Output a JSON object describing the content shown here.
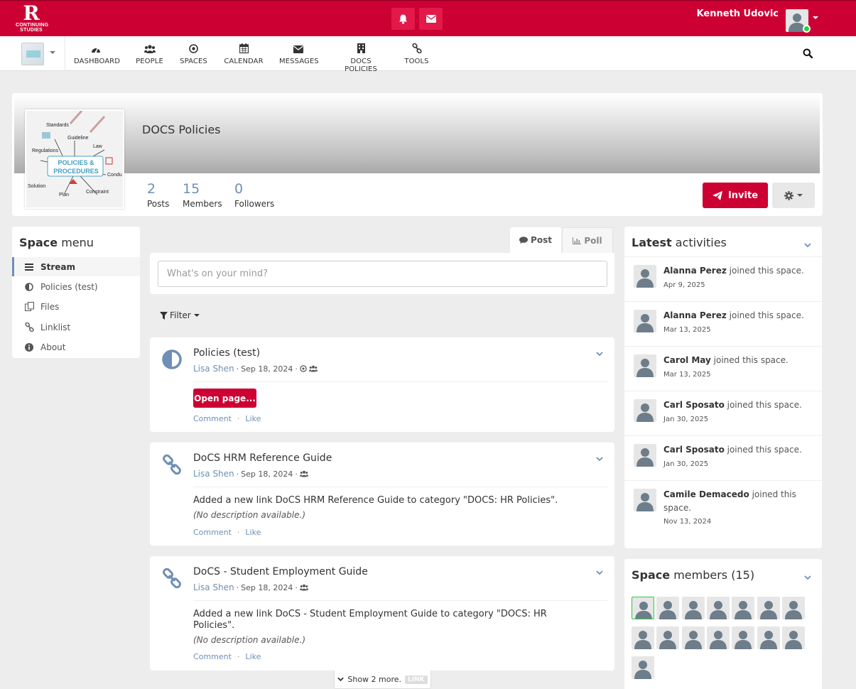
{
  "app": {
    "logo_letter": "R",
    "logo_sub": "CONTINUING STUDIES",
    "user_name": "Kenneth Udovic"
  },
  "nav": {
    "items": [
      {
        "label": "DASHBOARD",
        "icon": "dashboard-icon"
      },
      {
        "label": "PEOPLE",
        "icon": "people-icon"
      },
      {
        "label": "SPACES",
        "icon": "spaces-icon"
      },
      {
        "label": "CALENDAR",
        "icon": "calendar-icon"
      },
      {
        "label": "MESSAGES",
        "icon": "envelope-icon"
      },
      {
        "label": "DOCS POLICIES",
        "icon": "building-icon"
      },
      {
        "label": "TOOLS",
        "icon": "link-icon"
      }
    ]
  },
  "space": {
    "title": "DOCS Policies",
    "stats": [
      {
        "value": "2",
        "label": "Posts"
      },
      {
        "value": "15",
        "label": "Members"
      },
      {
        "value": "0",
        "label": "Followers"
      }
    ],
    "invite_label": "Invite",
    "image_words": [
      "Standards",
      "Guideline",
      "Regulations",
      "Law",
      "POLICIES &",
      "PROCEDURES",
      "Solution",
      "Plan",
      "Constraint",
      "Condu"
    ]
  },
  "space_menu": {
    "title_bold": "Space",
    "title_rest": " menu",
    "items": [
      {
        "label": "Stream",
        "icon": "bars-icon",
        "active": true
      },
      {
        "label": "Policies (test)",
        "icon": "adjust-icon"
      },
      {
        "label": "Files",
        "icon": "files-icon"
      },
      {
        "label": "Linklist",
        "icon": "link-icon"
      },
      {
        "label": "About",
        "icon": "info-icon"
      }
    ]
  },
  "composer": {
    "tab_post": "Post",
    "tab_poll": "Poll",
    "placeholder": "What's on your mind?",
    "filter_label": "Filter"
  },
  "stream": [
    {
      "title": "Policies (test)",
      "author": "Lisa Shen",
      "date": "Sep 18, 2024",
      "button": "Open page...",
      "actions": [
        "Comment",
        "Like"
      ]
    },
    {
      "title": "DoCS HRM Reference Guide",
      "author": "Lisa Shen",
      "date": "Sep 18, 2024",
      "text": "Added a new link DoCS HRM Reference Guide to category \"DOCS: HR Policies\".",
      "desc": "(No description available.)",
      "actions": [
        "Comment",
        "Like"
      ]
    },
    {
      "title": "DoCS - Student Employment Guide",
      "author": "Lisa Shen",
      "date": "Sep 18, 2024",
      "text_line1": "Added a new link DoCS - Student Employment Guide to category \"DOCS: HR",
      "text_line2": "Policies\".",
      "desc": "(No description available.)",
      "actions": [
        "Comment",
        "Like"
      ]
    }
  ],
  "show_more": {
    "label": "Show 2 more.",
    "badge": "LINK"
  },
  "activities": {
    "title_bold": "Latest",
    "title_rest": " activities",
    "items": [
      {
        "name": "Alanna Perez",
        "text": " joined this space.",
        "date": "Apr 9, 2025"
      },
      {
        "name": "Alanna Perez",
        "text": " joined this space.",
        "date": "Mar 13, 2025"
      },
      {
        "name": "Carol May",
        "text": " joined this space.",
        "date": "Mar 13, 2025"
      },
      {
        "name": "Carl Sposato",
        "text": " joined this space.",
        "date": "Jan 30, 2025"
      },
      {
        "name": "Carl Sposato",
        "text": " joined this space.",
        "date": "Jan 30, 2025"
      },
      {
        "name": "Camile Demacedo",
        "text": " joined this space.",
        "date": "Nov 13, 2024"
      }
    ]
  },
  "members": {
    "title_bold": "Space",
    "title_rest": " members (15)",
    "count": 15
  },
  "colors": {
    "brand_red": "#cc0033",
    "link_blue": "#6e8fb6",
    "online_green": "#2ecc40"
  }
}
